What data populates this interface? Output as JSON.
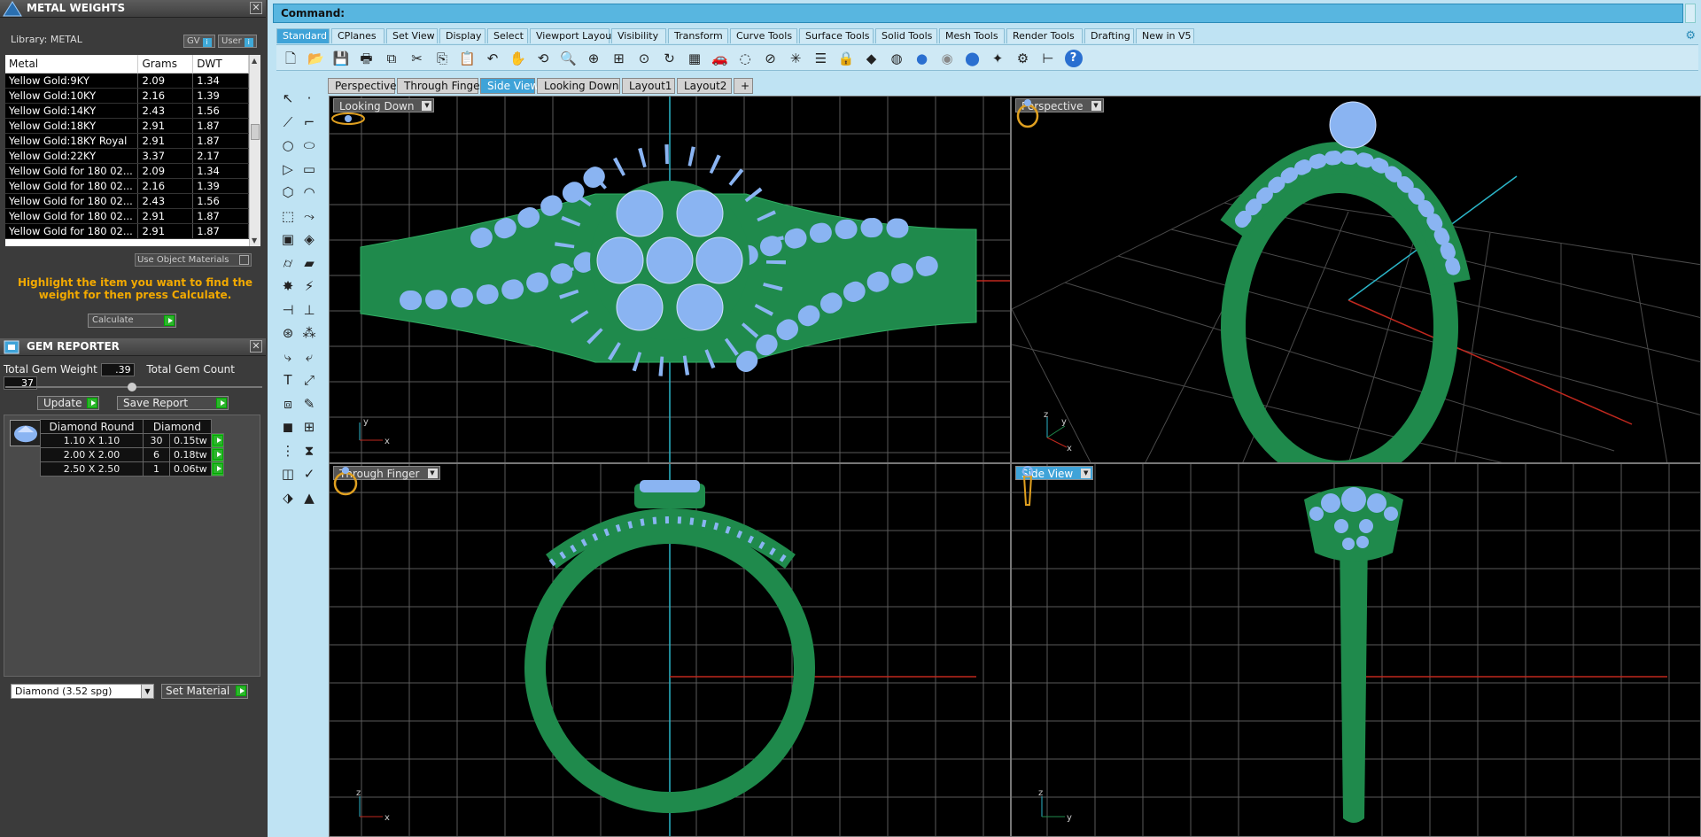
{
  "metal_panel": {
    "title": "METAL WEIGHTS",
    "library_label": "Library: METAL",
    "gv_label": "GV",
    "user_label": "User",
    "columns": [
      "Metal",
      "Grams",
      "DWT"
    ],
    "rows": [
      [
        "Yellow Gold:9KY",
        "2.09",
        "1.34"
      ],
      [
        "Yellow Gold:10KY",
        "2.16",
        "1.39"
      ],
      [
        "Yellow Gold:14KY",
        "2.43",
        "1.56"
      ],
      [
        "Yellow Gold:18KY",
        "2.91",
        "1.87"
      ],
      [
        "Yellow Gold:18KY Royal",
        "2.91",
        "1.87"
      ],
      [
        "Yellow Gold:22KY",
        "3.37",
        "2.17"
      ],
      [
        "Yellow Gold for 180 02...",
        "2.09",
        "1.34"
      ],
      [
        "Yellow Gold for 180 02...",
        "2.16",
        "1.39"
      ],
      [
        "Yellow Gold for 180 02...",
        "2.43",
        "1.56"
      ],
      [
        "Yellow Gold for 180 02...",
        "2.91",
        "1.87"
      ],
      [
        "Yellow Gold for 180 02...",
        "2.91",
        "1.87"
      ]
    ],
    "use_object_materials": "Use Object Materials",
    "hint": "Highlight the item you want to find the weight for then press Calculate.",
    "calculate_label": "Calculate"
  },
  "gem_panel": {
    "title": "GEM REPORTER",
    "total_weight_label": "Total Gem Weight",
    "total_weight_value": ".39",
    "total_count_label": "Total Gem Count",
    "total_count_value": "37",
    "update_label": "Update",
    "save_report_label": "Save Report",
    "columns": [
      "Diamond Round",
      "Diamond"
    ],
    "rows": [
      [
        "1.10 X 1.10",
        "30",
        "0.15tw"
      ],
      [
        "2.00 X 2.00",
        "6",
        "0.18tw"
      ],
      [
        "2.50 X 2.50",
        "1",
        "0.06tw"
      ]
    ],
    "material_select": "Diamond    (3.52 spg)",
    "set_material_label": "Set Material"
  },
  "command": {
    "label": "Command:"
  },
  "toolbar_tabs": [
    "Standard",
    "CPlanes",
    "Set View",
    "Display",
    "Select",
    "Viewport Layout",
    "Visibility",
    "Transform",
    "Curve Tools",
    "Surface Tools",
    "Solid Tools",
    "Mesh Tools",
    "Render Tools",
    "Drafting",
    "New in V5"
  ],
  "viewport_tabs": [
    "Perspective",
    "Through Finger",
    "Side View",
    "Looking Down",
    "Layout1",
    "Layout2"
  ],
  "active_viewport_tab": "Side View",
  "viewports": {
    "looking_down": "Looking Down",
    "perspective": "Perspective",
    "through_finger": "Through Finger",
    "side_view": "Side View"
  },
  "axis_labels": {
    "x": "x",
    "y": "y",
    "z": "z"
  },
  "colors": {
    "ring_green": "#1f8a4c",
    "gem_blue": "#8ab4f2",
    "accent": "#3fa3d8",
    "hint": "#f2a900"
  }
}
